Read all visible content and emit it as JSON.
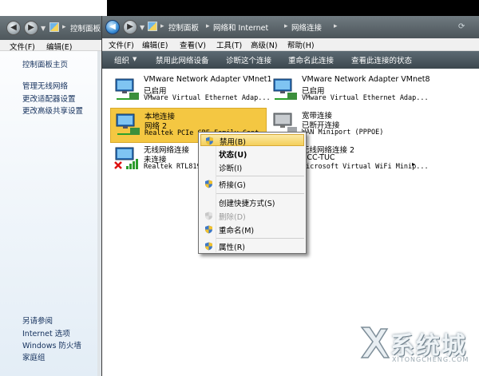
{
  "back_window": {
    "breadcrumb": "控制面板",
    "menu": [
      "文件(F)",
      "编辑(E)"
    ],
    "sidebar": {
      "home": "控制面板主页",
      "links": [
        "管理无线网络",
        "更改适配器设置",
        "更改高级共享设置"
      ],
      "see_also_title": "另请参阅",
      "see_also": [
        "Internet 选项",
        "Windows 防火墙",
        "家庭组"
      ]
    }
  },
  "front_window": {
    "breadcrumb": [
      "控制面板",
      "网络和 Internet",
      "网络连接"
    ],
    "menu": [
      "文件(F)",
      "编辑(E)",
      "查看(V)",
      "工具(T)",
      "高级(N)",
      "帮助(H)"
    ],
    "commands": [
      "组织",
      "禁用此网络设备",
      "诊断这个连接",
      "重命名此连接",
      "查看此连接的状态"
    ]
  },
  "adapters": [
    {
      "name": "VMware Network Adapter VMnet1",
      "status": "已启用",
      "device": "VMware Virtual Ethernet Adap..."
    },
    {
      "name": "VMware Network Adapter VMnet8",
      "status": "已启用",
      "device": "VMware Virtual Ethernet Adap..."
    },
    {
      "name": "本地连接",
      "status": "网络 2",
      "device": "Realtek PCIe GBE Family Cont..."
    },
    {
      "name": "宽带连接",
      "status": "已断开连接",
      "device": "WAN Miniport (PPPOE)"
    },
    {
      "name": "无线网络连接",
      "status": "未连接",
      "device": "Realtek RTL8191SE..."
    },
    {
      "name": "无线网络连接 2",
      "status": "ACC-TUC",
      "device": "Microsoft Virtual WiFi Minip..."
    }
  ],
  "context_menu": {
    "items": [
      {
        "label": "禁用(B)",
        "shield": true
      },
      {
        "label": "状态(U)",
        "shield": false
      },
      {
        "label": "诊断(I)",
        "shield": false
      },
      {
        "label": "桥接(G)",
        "shield": true
      },
      {
        "label": "创建快捷方式(S)",
        "shield": false
      },
      {
        "label": "删除(D)",
        "shield": true
      },
      {
        "label": "重命名(M)",
        "shield": true
      },
      {
        "label": "属性(R)",
        "shield": true
      }
    ]
  },
  "watermark": {
    "title": "系统城",
    "subtitle": "XITONGCHENG.COM"
  }
}
